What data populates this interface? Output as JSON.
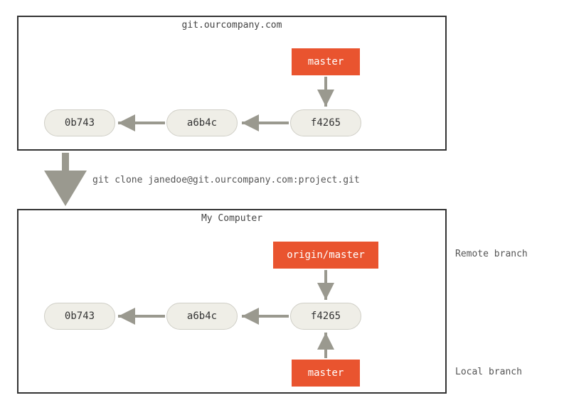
{
  "remote": {
    "title": "git.ourcompany.com",
    "commits": [
      "0b743",
      "a6b4c",
      "f4265"
    ],
    "branch_master": "master"
  },
  "clone_command": "git clone janedoe@git.ourcompany.com:project.git",
  "local": {
    "title": "My Computer",
    "commits": [
      "0b743",
      "a6b4c",
      "f4265"
    ],
    "branch_origin_master": "origin/master",
    "branch_master": "master",
    "remote_branch_label": "Remote branch",
    "local_branch_label": "Local branch"
  }
}
